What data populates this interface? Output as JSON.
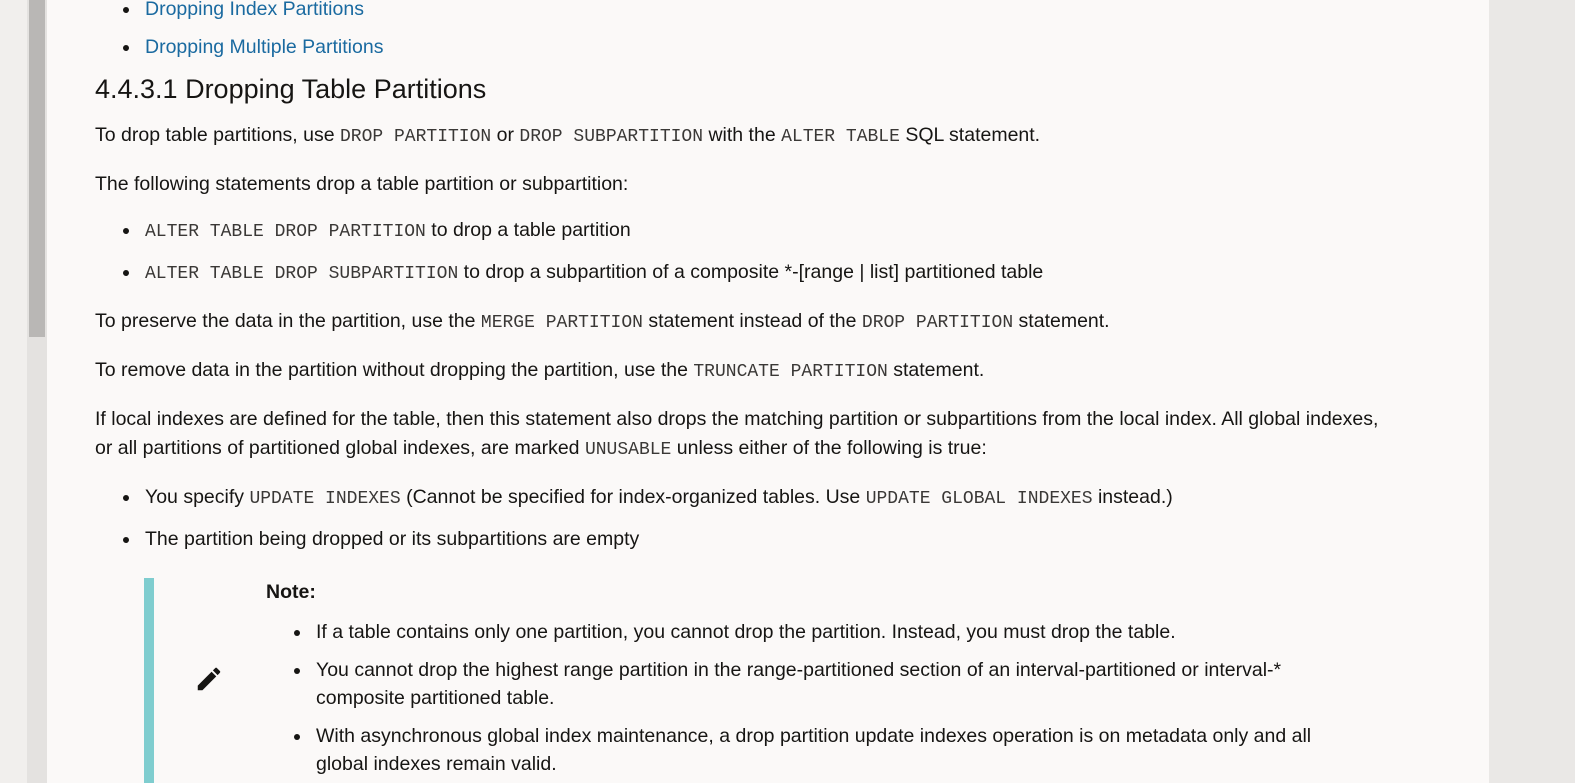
{
  "toc": {
    "items": [
      {
        "label": "Dropping Index Partitions"
      },
      {
        "label": "Dropping Multiple Partitions"
      }
    ]
  },
  "section": {
    "heading": "4.4.3.1 Dropping Table Partitions",
    "intro": {
      "t1": "To drop table partitions, use ",
      "c1": "DROP PARTITION",
      "t2": " or ",
      "c2": "DROP SUBPARTITION",
      "t3": " with the ",
      "c3": "ALTER TABLE",
      "t4": " SQL statement."
    },
    "statements_intro": "The following statements drop a table partition or subpartition:",
    "statements": [
      {
        "code": "ALTER TABLE DROP PARTITION",
        "text": " to drop a table partition"
      },
      {
        "code": "ALTER TABLE DROP SUBPARTITION",
        "text": " to drop a subpartition of a composite *-[range | list] partitioned table"
      }
    ],
    "preserve": {
      "t1": "To preserve the data in the partition, use the ",
      "c1": "MERGE PARTITION",
      "t2": " statement instead of the ",
      "c2": "DROP PARTITION",
      "t3": " statement."
    },
    "remove": {
      "t1": "To remove data in the partition without dropping the partition, use the ",
      "c1": "TRUNCATE PARTITION",
      "t2": " statement."
    },
    "local_indexes": {
      "t1": "If local indexes are defined for the table, then this statement also drops the matching partition or subpartitions from the local index. All global indexes, or all partitions of partitioned global indexes, are marked ",
      "c1": "UNUSABLE",
      "t2": " unless either of the following is true:"
    },
    "conditions": {
      "first": {
        "t1": "You specify ",
        "c1": "UPDATE INDEXES",
        "t2": " (Cannot be specified for index-organized tables. Use ",
        "c2": "UPDATE GLOBAL INDEXES",
        "t3": " instead.)"
      },
      "second": "The partition being dropped or its subpartitions are empty"
    }
  },
  "note": {
    "icon": "pencil-icon",
    "title": "Note:",
    "items": [
      "If a table contains only one partition, you cannot drop the partition. Instead, you must drop the table.",
      "You cannot drop the highest range partition in the range-partitioned section of an interval-partitioned or interval-* composite partitioned table.",
      "With asynchronous global index maintenance, a drop partition update indexes operation is on metadata only and all global indexes remain valid."
    ],
    "accent_color": "#7fcdcf"
  },
  "colors": {
    "link": "#1a6aa0",
    "text": "#161513",
    "page_background": "#fbf9f8"
  }
}
